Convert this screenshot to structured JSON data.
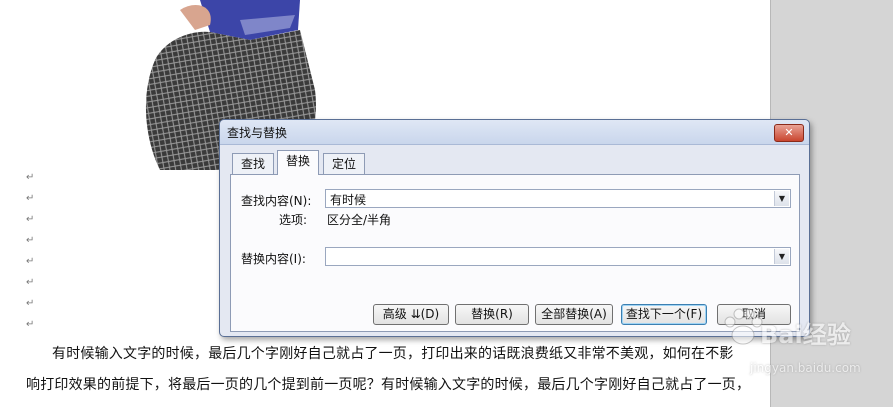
{
  "dialog": {
    "title": "查找与替换",
    "close_label": "✕",
    "tabs": [
      {
        "label": "查找"
      },
      {
        "label": "替换"
      },
      {
        "label": "定位"
      }
    ],
    "find_label": "查找内容(N):",
    "find_value": "有时候",
    "options_label": "选项:",
    "options_value": "区分全/半角",
    "replace_label": "替换内容(I):",
    "replace_value": "",
    "buttons": {
      "more": "高级 ⇊(D)",
      "replace": "替换(R)",
      "replace_all": "全部替换(A)",
      "find_next": "查找下一个(F)",
      "cancel": "取消"
    }
  },
  "document": {
    "paragraph_mark": "↵",
    "line1": "有时候输入文字的时候，最后几个字刚好自己就占了一页，打印出来的话既浪费纸又非常不美观，如何在不影",
    "line2": "响打印效果的前提下，将最后一页的几个提到前一页呢？有时候输入文字的时候，最后几个字刚好自己就占了一页，"
  },
  "watermark": {
    "brand": "Bai经验",
    "url": "jingyan.baidu.com"
  }
}
